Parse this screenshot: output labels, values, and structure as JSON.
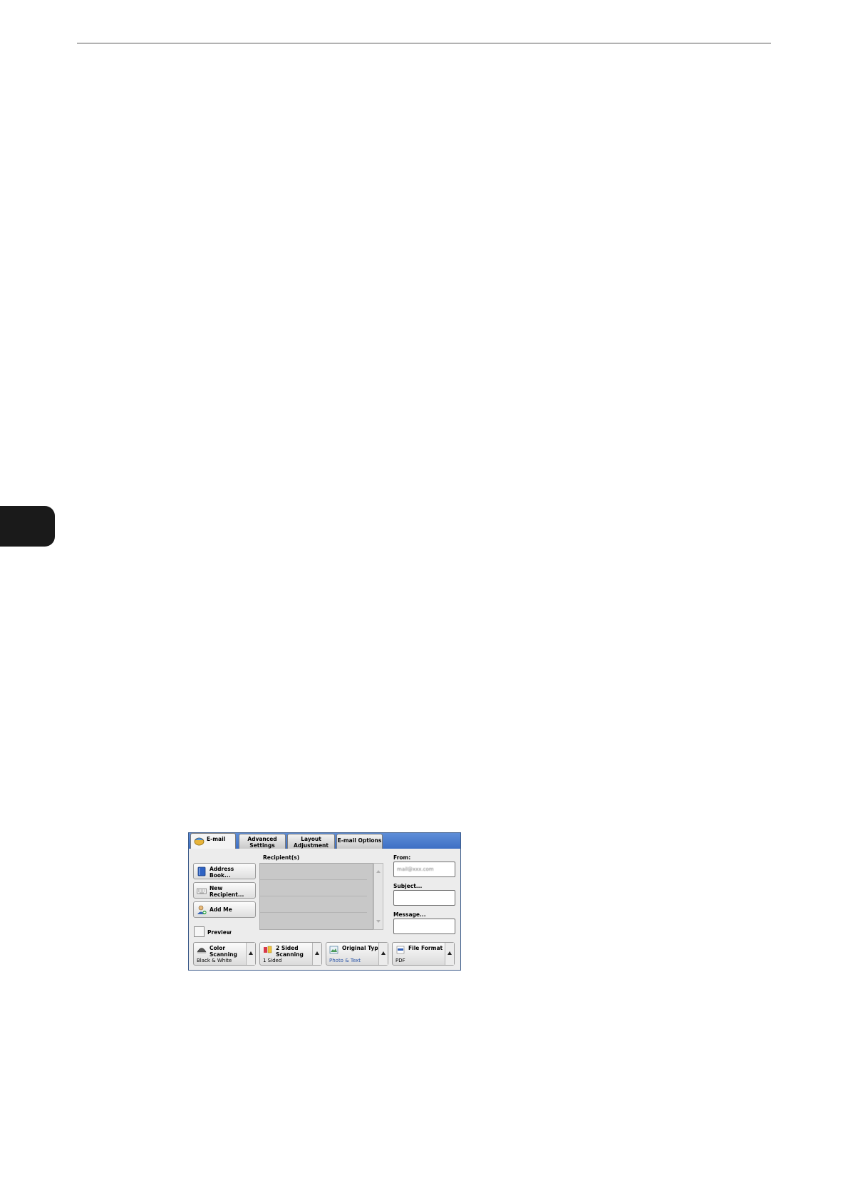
{
  "tabs": {
    "email": "E-mail",
    "advanced": [
      "Advanced",
      "Settings"
    ],
    "layout": [
      "Layout",
      "Adjustment"
    ],
    "options": "E-mail Options"
  },
  "left_buttons": {
    "address_book": [
      "Address",
      "Book..."
    ],
    "new_recipient": [
      "New",
      "Recipient..."
    ],
    "add_me": "Add Me"
  },
  "preview_label": "Preview",
  "recipients_label": "Recipient(s)",
  "fields": {
    "from_label": "From:",
    "from_value": "mail@xxx.com",
    "subject_label": "Subject...",
    "message_label": "Message..."
  },
  "features": {
    "color": {
      "title": [
        "Color",
        "Scanning"
      ],
      "value": "Black & White"
    },
    "sided": {
      "title": [
        "2 Sided",
        "Scanning"
      ],
      "value": "1 Sided"
    },
    "original": {
      "title": [
        "Original Type"
      ],
      "value": "Photo & Text"
    },
    "format": {
      "title": [
        "File Format"
      ],
      "value": "PDF"
    }
  },
  "colors": {
    "tabbar": "#4a7acd",
    "frame": "#3c5b8a",
    "value_blue": "#2b55a8"
  }
}
